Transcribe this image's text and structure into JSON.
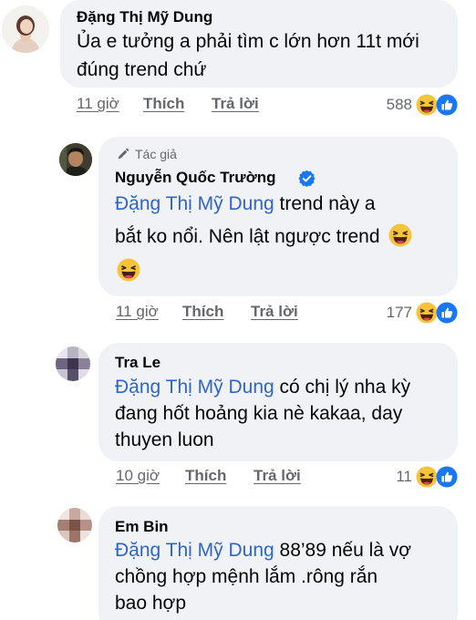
{
  "comments": [
    {
      "author": "Đặng Thị Mỹ Dung",
      "lines": [
        "Ủa e tưởng a phải tìm c lớn hơn 11t mới",
        "đúng trend chứ"
      ],
      "time": "11 giờ",
      "like_label": "Thích",
      "reply_label": "Trả lời",
      "reaction_count": "588"
    },
    {
      "author_badge": "Tác giả",
      "author": "Nguyễn Quốc Trường",
      "mention": "Đặng Thị Mỹ Dung",
      "line1_rest": " trend này a",
      "line2": "bắt ko nổi. Nên lật ngược trend",
      "time": "11 giờ",
      "like_label": "Thích",
      "reply_label": "Trả lời",
      "reaction_count": "177"
    },
    {
      "author": "Tra Le",
      "mention": "Đặng Thị Mỹ Dung",
      "line1_rest": " có chị lý nha kỳ",
      "line2": "đang hốt hoảng kia nè kakaa, day",
      "line3": "thuyen luon",
      "time": "10 giờ",
      "like_label": "Thích",
      "reply_label": "Trả lời",
      "reaction_count": "11"
    },
    {
      "author": "Em Bin",
      "mention": "Đặng Thị Mỹ Dung",
      "line1_rest": " 88’89 nếu là vợ",
      "line2": "chồng hợp mệnh lắm .rông rắn",
      "line3": "bao hợp"
    }
  ],
  "colors": {
    "bubble": "#f0f2f5",
    "mention": "#2f66c5",
    "meta_text": "#65676b",
    "like_blue": "#1877f2",
    "haha_yellow": "#f7c33b"
  },
  "icons": [
    "haha-emoji-icon",
    "like-thumb-icon",
    "verified-badge-icon",
    "pencil-icon"
  ]
}
